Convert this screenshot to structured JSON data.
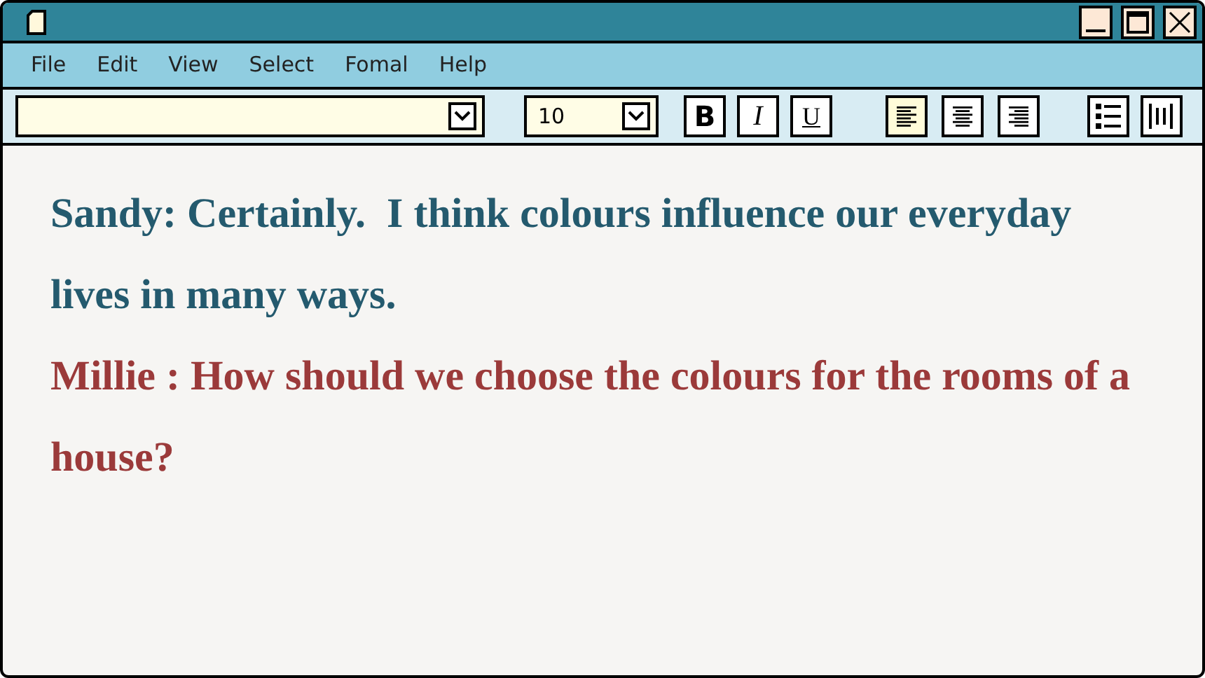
{
  "menu": [
    "File",
    "Edit",
    "View",
    "Select",
    "Fomal",
    "Help"
  ],
  "toolbar": {
    "font_size": "10",
    "format_buttons": [
      {
        "kind": "bold",
        "label": "B"
      },
      {
        "kind": "italic",
        "label": "I"
      },
      {
        "kind": "underline",
        "label": "U"
      }
    ],
    "align_buttons": [
      {
        "kind": "left",
        "selected": true
      },
      {
        "kind": "center",
        "selected": false
      },
      {
        "kind": "right",
        "selected": false
      }
    ],
    "list_buttons": [
      {
        "kind": "bullets"
      },
      {
        "kind": "columns"
      }
    ]
  },
  "paragraphs": [
    {
      "text": "Sandy: Certainly.  I think colours influence our everyday lives in many ways.",
      "color": "#245a6e"
    },
    {
      "text": "Millie : How should we choose the colours for the rooms of a house?",
      "color": "#9b3a3a"
    }
  ]
}
